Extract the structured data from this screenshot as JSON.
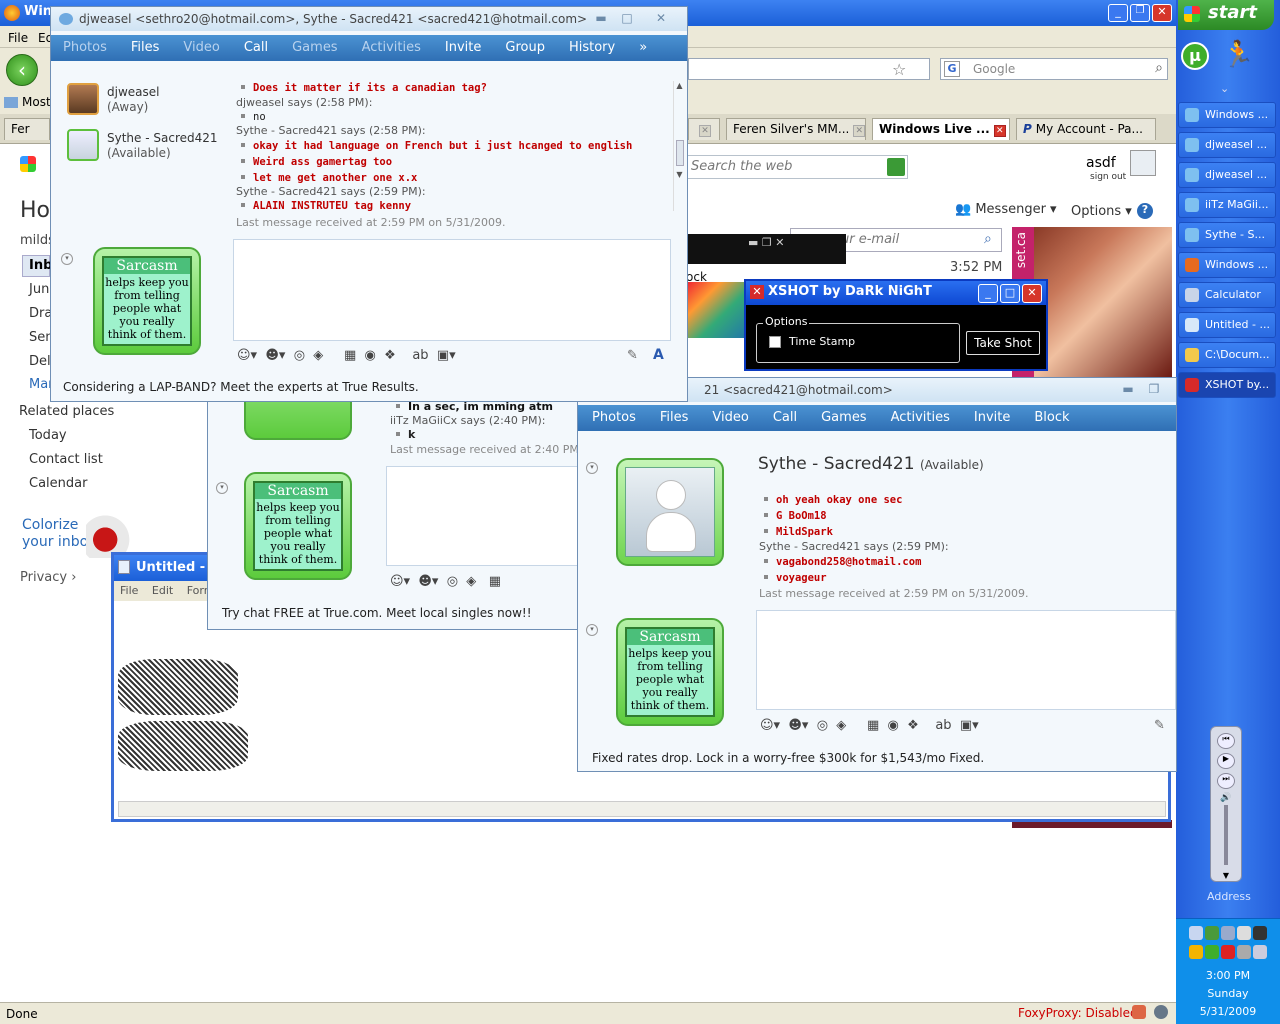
{
  "firefox": {
    "title": "Win",
    "menu": [
      "File",
      "Ed"
    ],
    "search_engine_placeholder": "Google",
    "bookmarks_label": "Most",
    "tabs": [
      {
        "label": "Fer"
      },
      {
        "label": "Feren Silver's MM..."
      },
      {
        "label": "Windows Live ..."
      },
      {
        "label": "My Account - Pa..."
      }
    ],
    "status": "Done",
    "foxyproxy": "FoxyProxy: Disabled"
  },
  "hotmail": {
    "logo_text": "Hot",
    "account_label": "milds",
    "nav": [
      "Inb",
      "Jun",
      "Dra",
      "Sen",
      "Dele",
      "Mar"
    ],
    "related_places_header": "Related places",
    "related_places": [
      "Today",
      "Contact list",
      "Calendar"
    ],
    "colorize_line1": "Colorize",
    "colorize_line2": "your inbox",
    "privacy": "Privacy",
    "search_placeholder": "Search the web",
    "user_name": "asdf",
    "sign_out": "sign out",
    "messenger_menu": "Messenger",
    "options_menu": "Options",
    "email_placeholder": "ur e-mail",
    "time": "3:52 PM",
    "ad_text": "set.ca",
    "mini_window_text": "ock"
  },
  "chat1": {
    "title": "djweasel <sethro20@hotmail.com>, Sythe - Sacred421 <sacred421@hotmail.com>",
    "toolbar": [
      "Photos",
      "Files",
      "Video",
      "Call",
      "Games",
      "Activities",
      "Invite",
      "Group",
      "History"
    ],
    "contacts": [
      {
        "name": "djweasel",
        "status": "(Away)"
      },
      {
        "name": "Sythe - Sacred421",
        "status": "(Available)"
      }
    ],
    "messages": [
      {
        "kind": "msg",
        "text": "Does it matter if its a canadian tag?"
      },
      {
        "kind": "says",
        "text": "djweasel says (2:58 PM):"
      },
      {
        "kind": "msgblack",
        "text": "no"
      },
      {
        "kind": "says",
        "text": "Sythe - Sacred421 says (2:58 PM):"
      },
      {
        "kind": "msg",
        "text": "okay it had language on French but i just hcanged to english"
      },
      {
        "kind": "msg",
        "text": "Weird ass gamertag too"
      },
      {
        "kind": "msg",
        "text": "let me get another one x.x"
      },
      {
        "kind": "says",
        "text": "Sythe - Sacred421 says (2:59 PM):"
      },
      {
        "kind": "msg",
        "text": "ALAIN INSTRUTEU tag kenny"
      }
    ],
    "last_message": "Last message received at 2:59 PM on 5/31/2009.",
    "ad": "Considering a LAP-BAND? Meet the experts at True Results."
  },
  "chat2": {
    "messages": [
      {
        "kind": "msgblack",
        "text": "In a sec, im mming atm"
      },
      {
        "kind": "says",
        "text": "iiTz MaGiiCx says (2:40 PM):"
      },
      {
        "kind": "msgblack",
        "text": "k"
      }
    ],
    "last_message": "Last message received at 2:40 PM o",
    "ad": "Try chat FREE at True.com. Meet local singles now!!"
  },
  "chat3": {
    "title": "21 <sacred421@hotmail.com>",
    "toolbar": [
      "Photos",
      "Files",
      "Video",
      "Call",
      "Games",
      "Activities",
      "Invite",
      "Block"
    ],
    "contact_name": "Sythe - Sacred421",
    "contact_status": "(Available)",
    "messages": [
      {
        "kind": "msg",
        "text": "oh yeah okay one sec"
      },
      {
        "kind": "msg",
        "text": "G BoOm18"
      },
      {
        "kind": "msg",
        "text": "MildSpark"
      },
      {
        "kind": "says",
        "text": "Sythe - Sacred421 says (2:59 PM):"
      },
      {
        "kind": "msg",
        "text": "vagabond258@hotmail.com"
      },
      {
        "kind": "msg",
        "text": "voyageur"
      }
    ],
    "last_message": "Last message received at 2:59 PM on 5/31/2009.",
    "ad": "Fixed rates drop. Lock in a worry-free $300k for $1,543/mo Fixed."
  },
  "sarcasm_card": {
    "title": "Sarcasm",
    "body": "helps keep you from telling people what you really think of them."
  },
  "xshot": {
    "title": "XSHOT by DaRk NiGhT",
    "options_label": "Options",
    "timestamp_label": "Time Stamp",
    "take_shot": "Take Shot"
  },
  "notepad": {
    "title": "Untitled - N",
    "menu": [
      "File",
      "Edit",
      "Forma"
    ]
  },
  "taskbar": {
    "start": "start",
    "items": [
      {
        "label": "Windows ...",
        "icon": "messenger-icon",
        "color": "#7ec0f0"
      },
      {
        "label": "djweasel ...",
        "icon": "messenger-icon",
        "color": "#7ec0f0"
      },
      {
        "label": "djweasel ...",
        "icon": "messenger-icon",
        "color": "#7ec0f0"
      },
      {
        "label": "iiTz MaGii...",
        "icon": "messenger-icon",
        "color": "#7ec0f0"
      },
      {
        "label": "Sythe - S...",
        "icon": "messenger-icon",
        "color": "#7ec0f0"
      },
      {
        "label": "Windows ...",
        "icon": "firefox-icon",
        "color": "#e66a1f"
      },
      {
        "label": "Calculator",
        "icon": "calculator-icon",
        "color": "#c8d4e8"
      },
      {
        "label": "Untitled - ...",
        "icon": "notepad-icon",
        "color": "#d8e8f8"
      },
      {
        "label": "C:\\Docum...",
        "icon": "folder-icon",
        "color": "#f2c94c"
      },
      {
        "label": "XSHOT by...",
        "icon": "xshot-icon",
        "color": "#d62a2a"
      }
    ],
    "address_label": "Address",
    "clock_time": "3:00 PM",
    "clock_day": "Sunday",
    "clock_date": "5/31/2009"
  }
}
